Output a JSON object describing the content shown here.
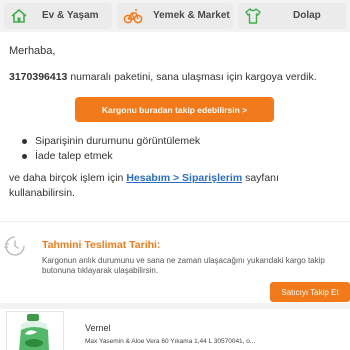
{
  "categories": [
    {
      "label": "Ev & Yaşam",
      "icon": "home-icon"
    },
    {
      "label": "Yemek & Market",
      "icon": "bicycle-icon"
    },
    {
      "label": "Dolap",
      "icon": "tshirt-icon"
    }
  ],
  "email": {
    "greeting": "Merhaba,",
    "order_number": "3170396413",
    "order_text": " numaralı paketini, sana ulaşması için kargoya verdik.",
    "track_button": "Kargonu buradan takip edebilirsin >",
    "bullets": [
      "Siparişinin durumunu görüntülemek",
      "İade talep etmek"
    ],
    "more_prefix": "ve daha birçok işlem için ",
    "more_link": "Hesabım > Siparişlerim",
    "more_suffix": " sayfanı kullanabilirsin."
  },
  "delivery": {
    "title": "Tahmini Teslimat Tarihi:",
    "description": "Kargonun anlık durumunu ve sana ne zaman ulaşacağını yukarıdaki kargo takip butonuna tıklayarak ulaşabilirsin.",
    "seller_button": "Satıcıyı Takip Et"
  },
  "product": {
    "brand": "Vernel",
    "name": "Max Yasemin & Aloe Vera 60 Yıkama 1,44 L 30570041, o..."
  },
  "colors": {
    "accent": "#f27a1a",
    "link": "#2b6cc4"
  }
}
